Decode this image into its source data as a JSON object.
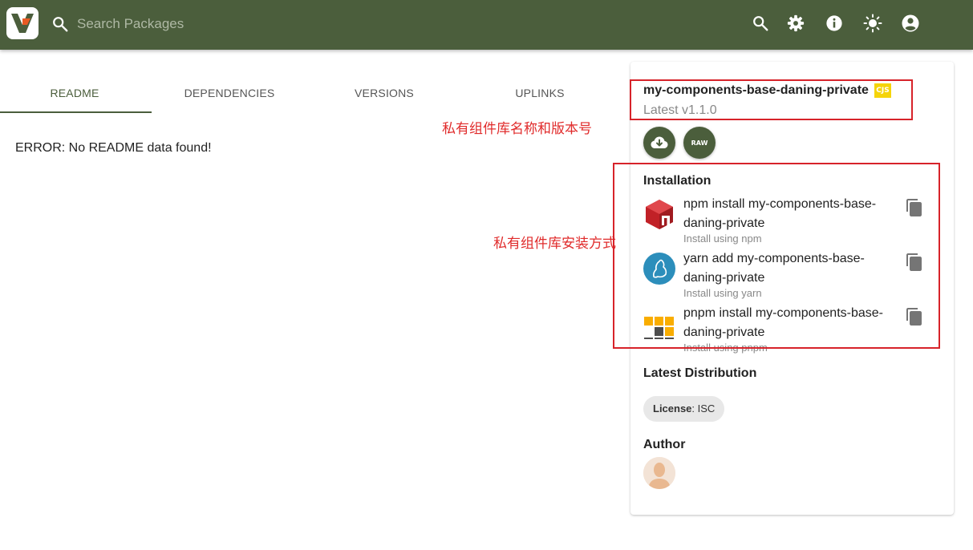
{
  "header": {
    "search_placeholder": "Search Packages",
    "icons": [
      "search-icon",
      "gear-icon",
      "info-icon",
      "theme-sun-icon",
      "account-icon"
    ],
    "bg_color": "#4b5e3c"
  },
  "tabs": [
    {
      "label": "README",
      "active": true
    },
    {
      "label": "DEPENDENCIES",
      "active": false
    },
    {
      "label": "VERSIONS",
      "active": false
    },
    {
      "label": "UPLINKS",
      "active": false
    }
  ],
  "readme": {
    "error": "ERROR: No README data found!"
  },
  "annotations": {
    "name_version": "私有组件库名称和版本号",
    "install": "私有组件库安装方式",
    "color": "#e02b2b"
  },
  "package": {
    "name": "my-components-base-daning-private",
    "badge": "CJS",
    "version": "Latest v1.1.0"
  },
  "actions": {
    "raw_label": "RAW"
  },
  "installation": {
    "title": "Installation",
    "items": [
      {
        "cmd": "npm install my-components-base-daning-private",
        "sub": "Install using npm",
        "icon": "npm-icon"
      },
      {
        "cmd": "yarn add my-components-base-daning-private",
        "sub": "Install using yarn",
        "icon": "yarn-icon"
      },
      {
        "cmd": "pnpm install my-components-base-daning-private",
        "sub": "Install using pnpm",
        "icon": "pnpm-icon"
      }
    ]
  },
  "distribution": {
    "title": "Latest Distribution",
    "license_label": "License",
    "license_value": ": ISC"
  },
  "author": {
    "title": "Author"
  }
}
